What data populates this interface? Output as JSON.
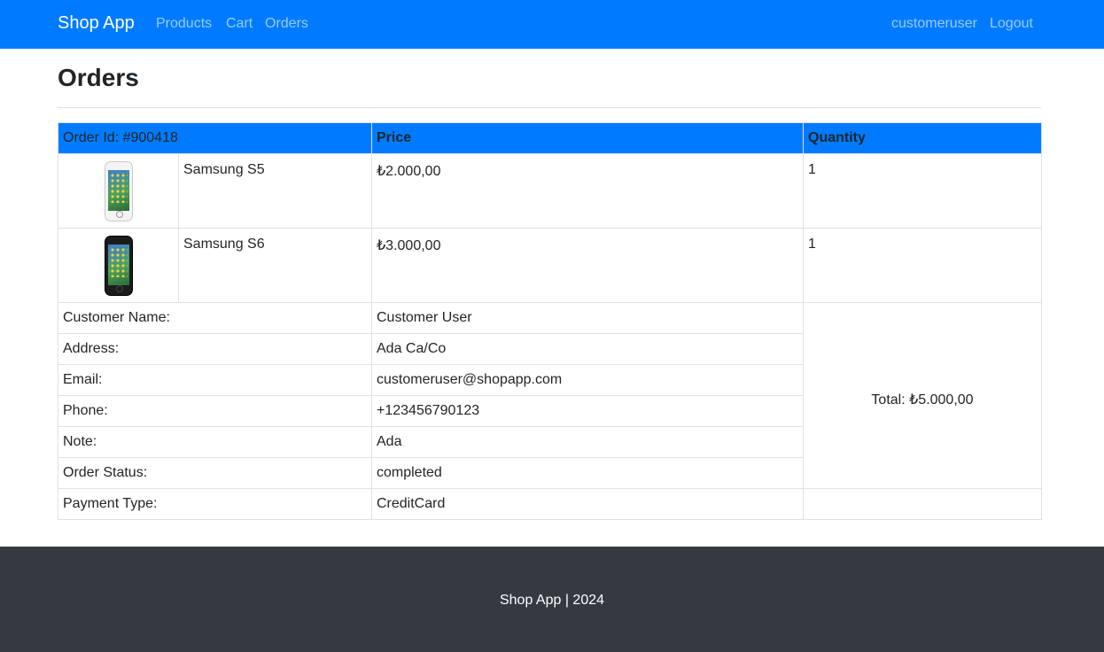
{
  "navbar": {
    "brand": "Shop App",
    "links": [
      "Products",
      "Cart",
      "Orders"
    ],
    "username": "customeruser",
    "logout": "Logout"
  },
  "page": {
    "title": "Orders"
  },
  "order": {
    "header": {
      "order_id": "Order Id: #900418",
      "price": "Price",
      "quantity": "Quantity"
    },
    "items": [
      {
        "image_icon": "phone-white-icon",
        "name": "Samsung S5",
        "price": "₺2.000,00",
        "quantity": "1"
      },
      {
        "image_icon": "phone-black-icon",
        "name": "Samsung S6",
        "price": "₺3.000,00",
        "quantity": "1"
      }
    ],
    "total": "Total: ₺5.000,00",
    "details": [
      {
        "label": "Customer Name:",
        "value": "Customer User"
      },
      {
        "label": "Address:",
        "value": "Ada Ca/Co"
      },
      {
        "label": "Email:",
        "value": "customeruser@shopapp.com"
      },
      {
        "label": "Phone:",
        "value": "+123456790123"
      },
      {
        "label": "Note:",
        "value": "Ada"
      },
      {
        "label": "Order Status:",
        "value": "completed"
      },
      {
        "label": "Payment Type:",
        "value": "CreditCard"
      }
    ]
  },
  "footer": {
    "text": "Shop App | 2024"
  },
  "colors": {
    "primary": "#007bff",
    "footer_bg": "#343a40",
    "border": "#dee2e6"
  }
}
